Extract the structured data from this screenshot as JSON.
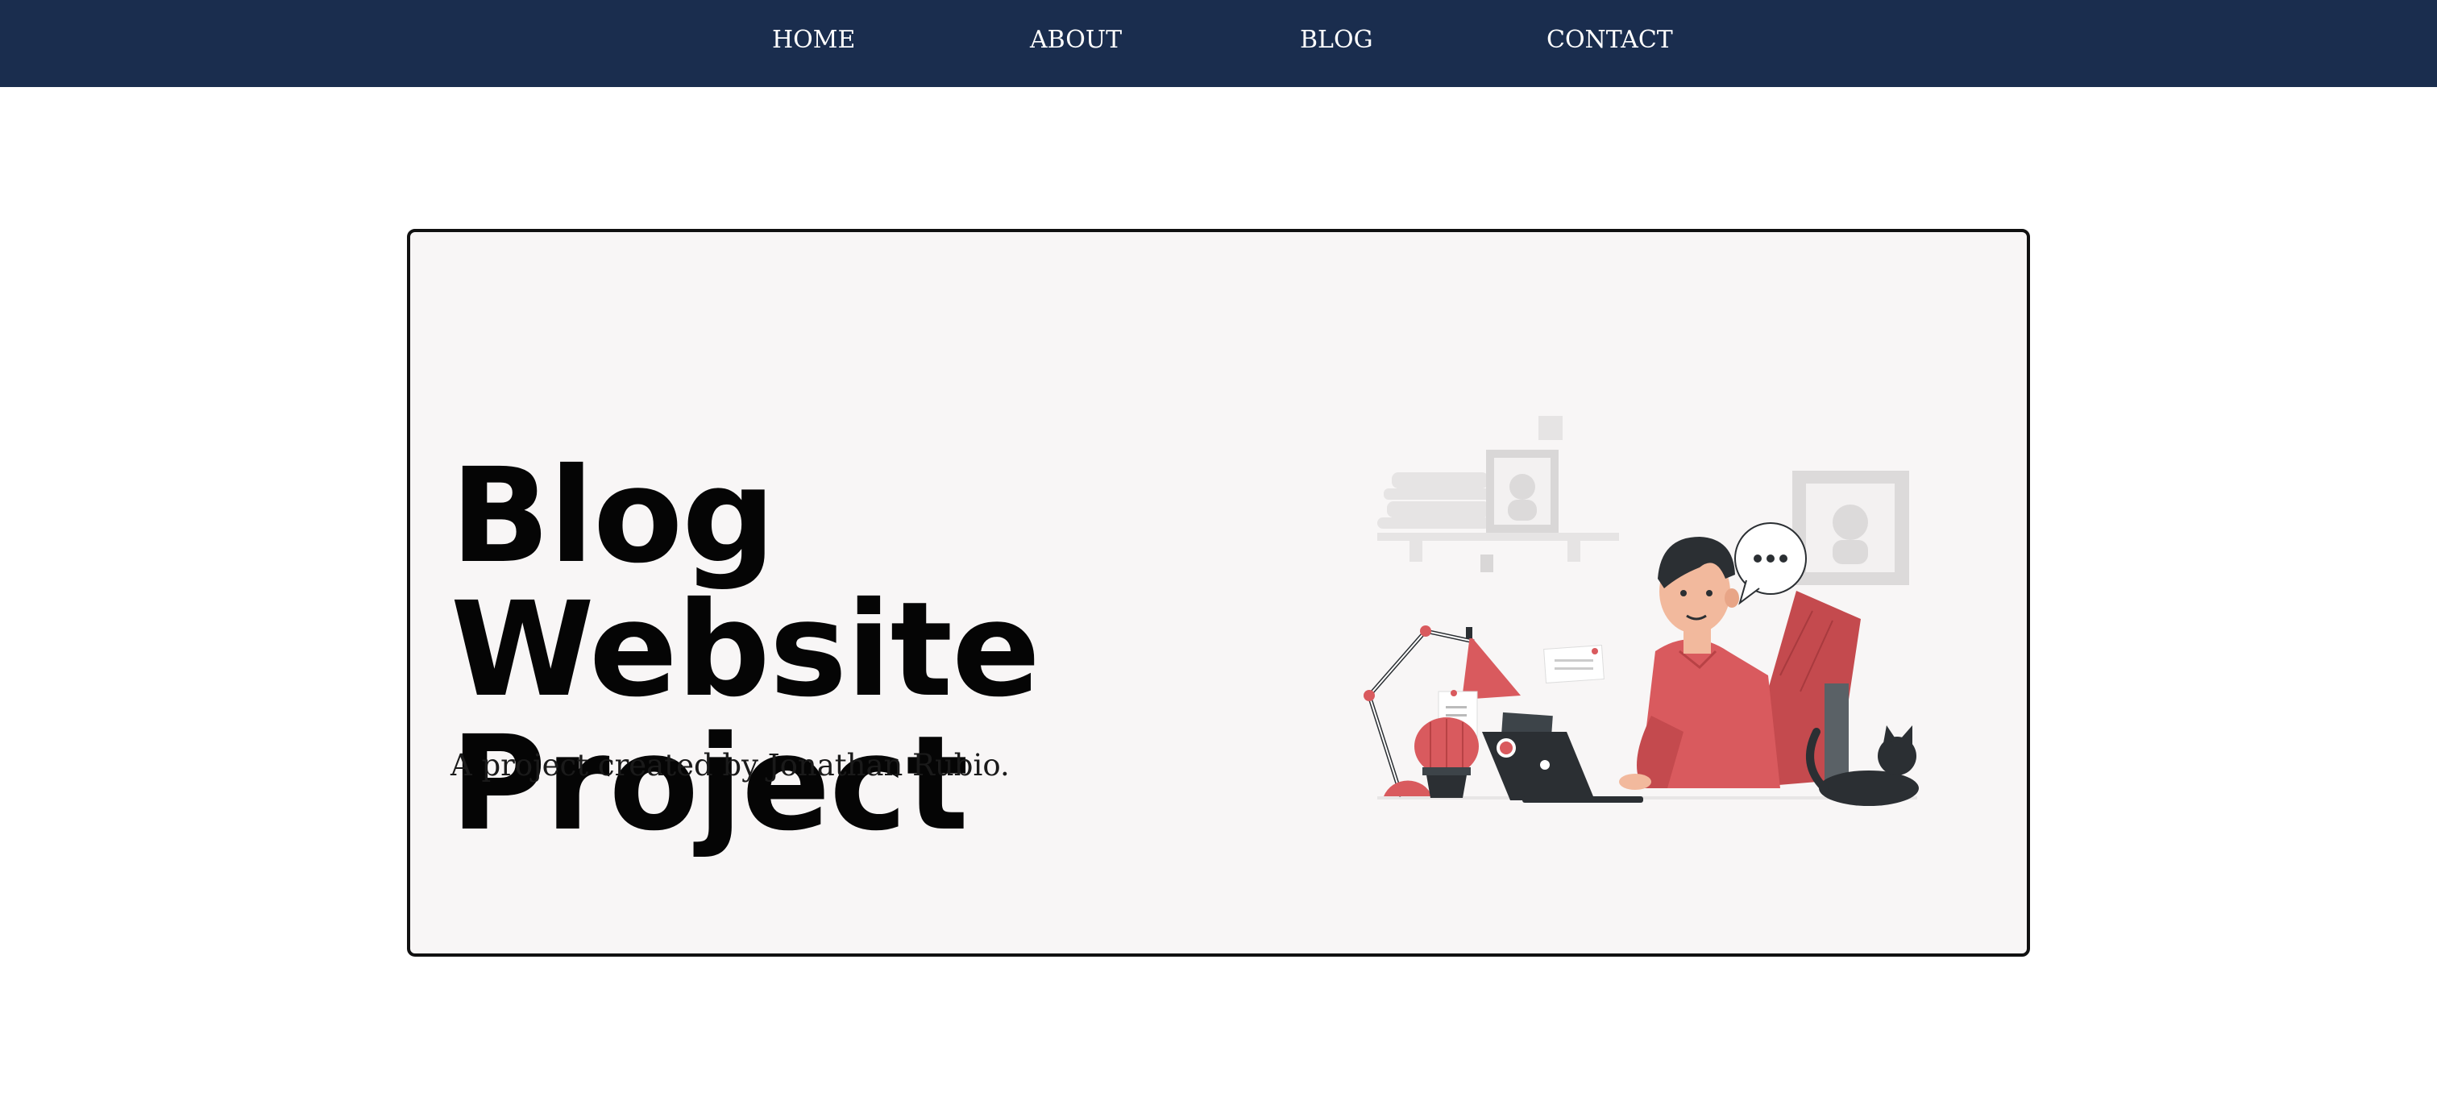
{
  "nav": {
    "items": [
      "HOME",
      "ABOUT",
      "BLOG",
      "CONTACT"
    ]
  },
  "hero": {
    "title": "Blog Website Project",
    "subtitle": "A project created by Jonathan Rubio.",
    "illustration": "person-working-at-laptop-illustration"
  },
  "colors": {
    "navbar_bg": "#1a2d4e",
    "nav_text": "#ffffff",
    "card_bg": "#f8f6f6",
    "card_border": "#111111",
    "accent": "#d95a5e",
    "dark": "#2b2f33"
  }
}
